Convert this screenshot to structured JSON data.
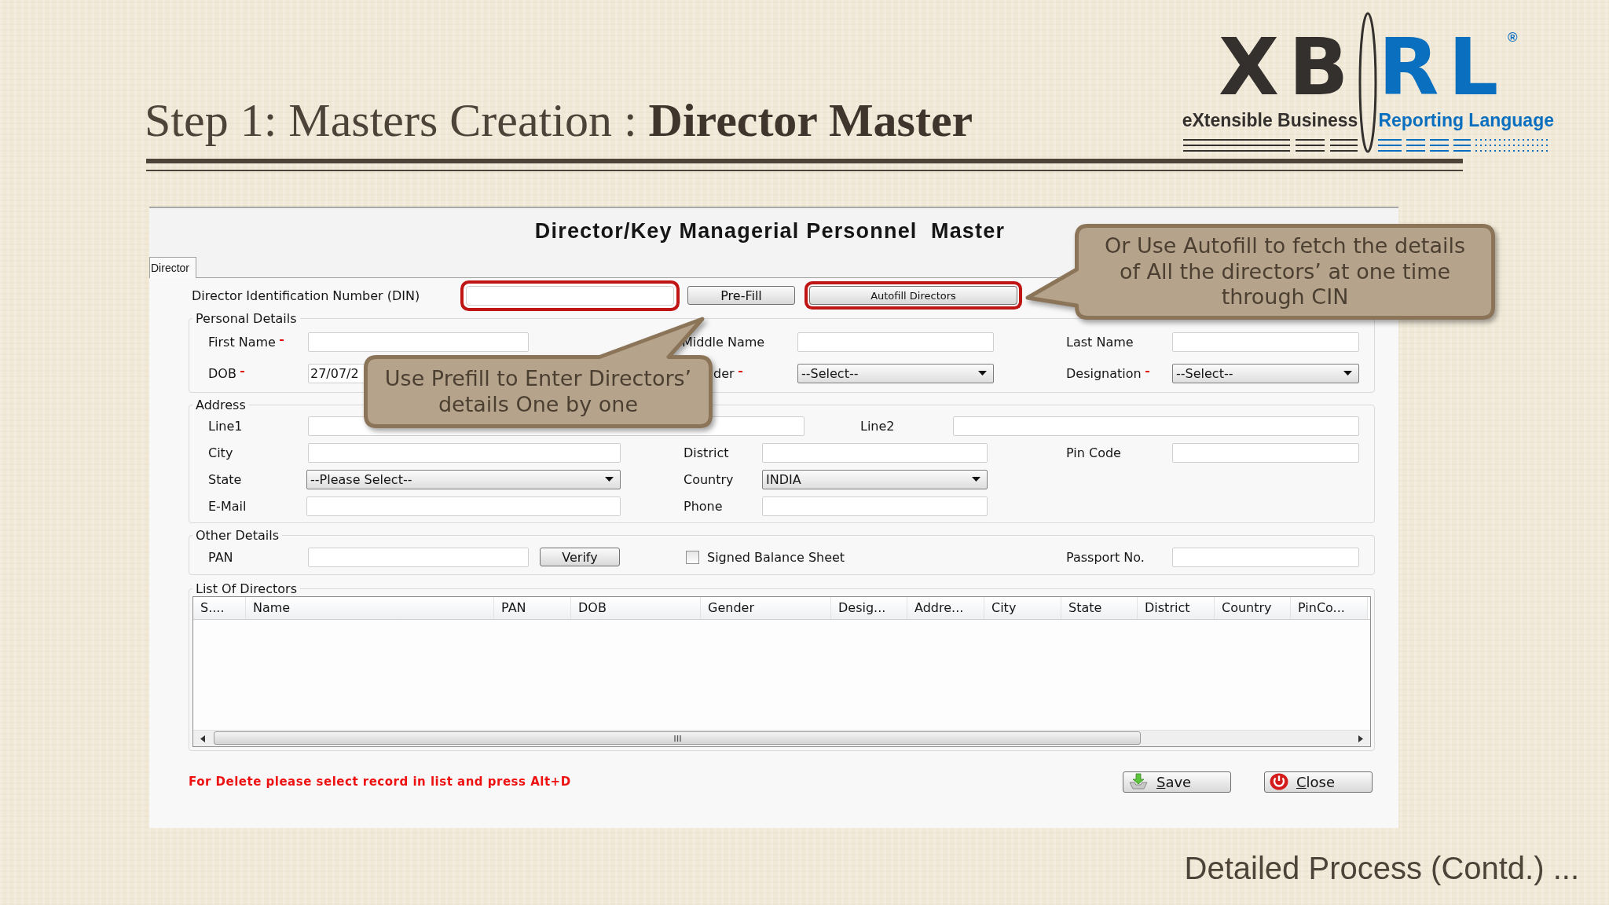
{
  "slide": {
    "title": "Step 1: Masters Creation : **Director Master**",
    "footer": "Detailed Process (Contd.) ..."
  },
  "logo": {
    "wordmark_left": "XB",
    "wordmark_right": "RL",
    "registered": "®",
    "tagline_left": "eXtensible Business",
    "tagline_right": "Reporting Language"
  },
  "window": {
    "title": "Director/Key Managerial Personnel  Master"
  },
  "tabs": [
    {
      "label": "Director",
      "selected": true
    }
  ],
  "din_row": [
    {
      "kind": "text",
      "label": "Director Identification Number (DIN)",
      "required": false,
      "highlighted": true
    },
    {
      "kind": "button",
      "label": "Pre-Fill",
      "highlighted": false
    },
    {
      "kind": "button",
      "label": "Autofill Directors",
      "highlighted": true
    }
  ],
  "groups": [
    {
      "legend": "Personal Details",
      "rows": [
        [
          {
            "kind": "text",
            "label": "First Name",
            "required": true
          },
          {
            "kind": "text",
            "label": "Middle Name",
            "required": false
          },
          {
            "kind": "text",
            "label": "Last Name",
            "required": false
          }
        ],
        [
          {
            "kind": "text",
            "label": "DOB",
            "required": true,
            "value": "27/07/2"
          },
          {
            "kind": "select",
            "label": "der",
            "required": true,
            "value": "--Select--"
          },
          {
            "kind": "select",
            "label": "Designation",
            "required": true,
            "value": "--Select--"
          }
        ]
      ]
    },
    {
      "legend": "Address",
      "rows": [
        [
          {
            "kind": "text",
            "label": "Line1",
            "required": false
          },
          {
            "kind": "text",
            "label": "Line2",
            "required": false
          }
        ],
        [
          {
            "kind": "text",
            "label": "City",
            "required": false
          },
          {
            "kind": "text",
            "label": "District",
            "required": false
          },
          {
            "kind": "text",
            "label": "Pin Code",
            "required": false
          }
        ],
        [
          {
            "kind": "select",
            "label": "State",
            "required": false,
            "value": "--Please Select--"
          },
          {
            "kind": "select",
            "label": "Country",
            "required": false,
            "value": "INDIA"
          }
        ],
        [
          {
            "kind": "text",
            "label": "E-Mail",
            "required": false
          },
          {
            "kind": "text",
            "label": "Phone",
            "required": false
          }
        ]
      ]
    },
    {
      "legend": "Other Details",
      "rows": [
        [
          {
            "kind": "text",
            "label": "PAN",
            "required": false
          },
          {
            "kind": "button",
            "label": "Verify",
            "highlighted": false
          },
          {
            "kind": "checkbox",
            "label": "Signed Balance Sheet",
            "checked": false
          },
          {
            "kind": "text",
            "label": "Passport No.",
            "required": false
          }
        ]
      ]
    }
  ],
  "list": {
    "legend": "List Of Directors",
    "columns": [
      "S....",
      "Name",
      "PAN",
      "DOB",
      "Gender",
      "Desig...",
      "Addre...",
      "City",
      "State",
      "District",
      "Country",
      "PinCo..."
    ]
  },
  "note": "For Delete please select record in list and press Alt+D",
  "actions": [
    {
      "label": "Save"
    },
    {
      "label": "Close"
    }
  ],
  "callouts": [
    {
      "text": "Use Prefill to Enter Directors’\ndetails One by one"
    },
    {
      "text": "Or Use Autofill to fetch the details\nof All the directors’ at one time\nthrough CIN"
    }
  ]
}
